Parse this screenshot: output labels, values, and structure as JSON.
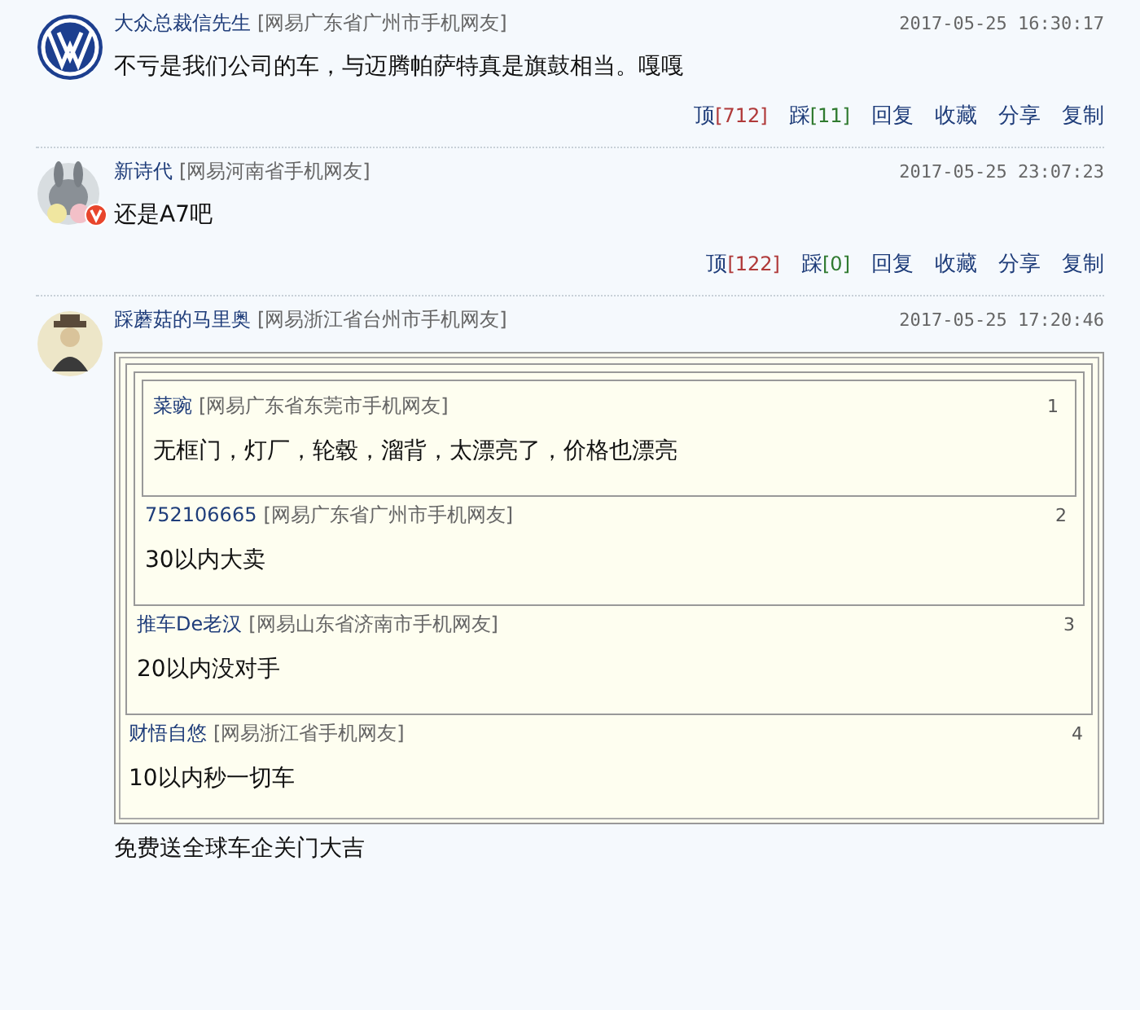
{
  "comments": [
    {
      "kind": "logo",
      "verified": false,
      "user": "大众总裁信先生",
      "location": "[网易广东省广州市手机网友]",
      "time": "2017-05-25 16:30:17",
      "text": "不亏是我们公司的车，与迈腾帕萨特真是旗鼓相当。嘎嘎",
      "actions": {
        "up_label": "顶",
        "up_count": "[712]",
        "down_label": "踩",
        "down_count": "[11]",
        "links": [
          "回复",
          "收藏",
          "分享",
          "复制"
        ]
      }
    },
    {
      "kind": "cartoon",
      "verified": true,
      "user": "新诗代",
      "location": "[网易河南省手机网友]",
      "time": "2017-05-25 23:07:23",
      "text": "还是A7吧",
      "actions": {
        "up_label": "顶",
        "up_count": "[122]",
        "down_label": "踩",
        "down_count": "[0]",
        "links": [
          "回复",
          "收藏",
          "分享",
          "复制"
        ]
      }
    },
    {
      "kind": "figure",
      "verified": false,
      "user": "踩蘑菇的马里奥",
      "location": "[网易浙江省台州市手机网友]",
      "time": "2017-05-25 17:20:46",
      "quotes": [
        {
          "user": "菜豌",
          "location": "[网易广东省东莞市手机网友]",
          "floor": "1",
          "text": "无框门，灯厂，轮毂，溜背，太漂亮了，价格也漂亮"
        },
        {
          "user": "752106665",
          "location": "[网易广东省广州市手机网友]",
          "floor": "2",
          "text": "30以内大卖"
        },
        {
          "user": "推车De老汉",
          "location": "[网易山东省济南市手机网友]",
          "floor": "3",
          "text": "20以内没对手"
        },
        {
          "user": "财悟自悠",
          "location": "[网易浙江省手机网友]",
          "floor": "4",
          "text": "10以内秒一切车"
        }
      ],
      "text": "免费送全球车企关门大吉"
    }
  ]
}
